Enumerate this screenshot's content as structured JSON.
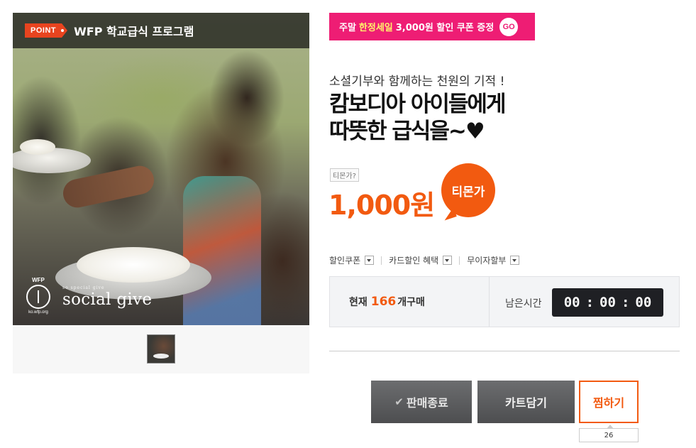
{
  "product_image": {
    "badge": "POINT",
    "program_title": "WFP 학교급식 프로그램",
    "wfp_logo_text": "WFP",
    "wfp_url": "ko.wfp.org",
    "brand_small": "so special give",
    "brand_big": "social give"
  },
  "promo": {
    "text_prefix": "주말",
    "text_highlight": "한정세일",
    "text_suffix": "3,000원 할인 쿠폰 증정",
    "go_label": "GO"
  },
  "deal": {
    "subtitle": "소셜기부와 함께하는 천원의 기적 !",
    "title_line1": "캄보디아 아이들에게",
    "title_line2": "따뜻한 급식을~♥",
    "price_label": "티몬가?",
    "price": "1,000원",
    "price_badge": "티몬가"
  },
  "options": [
    {
      "label": "할인쿠폰"
    },
    {
      "label": "카드할인 혜택"
    },
    {
      "label": "무이자할부"
    }
  ],
  "status": {
    "current_prefix": "현재",
    "purchase_count": "166",
    "current_suffix": "개구매",
    "remain_label": "남은시간",
    "timer": {
      "h": "00",
      "m": "00",
      "s": "00",
      "sep": ":"
    }
  },
  "actions": {
    "soldout_label": "판매종료",
    "cart_label": "카트담기",
    "wish_label": "찜하기",
    "wish_count": "26"
  },
  "colors": {
    "accent": "#f25a10",
    "promo": "#ee1d74",
    "promo_highlight": "#fff36b",
    "timer_bg": "#1f2024"
  }
}
